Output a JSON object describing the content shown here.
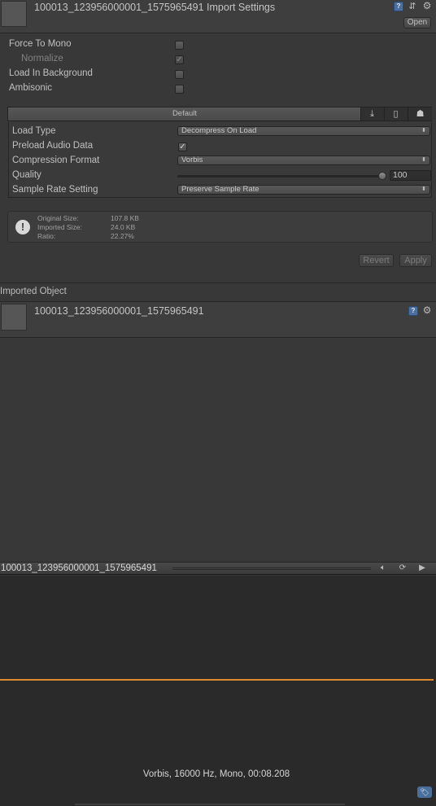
{
  "header": {
    "title": "100013_123956000001_1575965491 Import Settings",
    "open_label": "Open",
    "icons": [
      "help-book-icon",
      "presets-icon",
      "gear-icon"
    ]
  },
  "options": {
    "force_to_mono": {
      "label": "Force To Mono",
      "checked": false
    },
    "normalize": {
      "label": "Normalize",
      "checked": true
    },
    "load_in_background": {
      "label": "Load In Background",
      "checked": false
    },
    "ambisonic": {
      "label": "Ambisonic",
      "checked": false
    }
  },
  "platform_tabs": {
    "default_label": "Default",
    "icons": [
      "download-icon",
      "mobile-icon",
      "android-icon"
    ]
  },
  "settings": {
    "load_type": {
      "label": "Load Type",
      "value": "Decompress On Load"
    },
    "preload_audio_data": {
      "label": "Preload Audio Data",
      "checked": true
    },
    "compression_format": {
      "label": "Compression Format",
      "value": "Vorbis"
    },
    "quality": {
      "label": "Quality",
      "value": "100",
      "level": 1.0
    },
    "sample_rate_setting": {
      "label": "Sample Rate Setting",
      "value": "Preserve Sample Rate"
    }
  },
  "info": {
    "original_size_label": "Original Size:",
    "original_size": "107.8 KB",
    "imported_size_label": "Imported Size:",
    "imported_size": "24.0 KB",
    "ratio_label": "Ratio:",
    "ratio": "22.27%"
  },
  "actions": {
    "revert_label": "Revert",
    "apply_label": "Apply"
  },
  "imported_object": {
    "section_label": "Imported Object",
    "name": "100013_123956000001_1575965491"
  },
  "preview": {
    "name": "100013_123956000001_1575965491",
    "audio_info": "Vorbis, 16000 Hz, Mono, 00:08.208",
    "waveform_color": "#e08a2e"
  },
  "colors": {
    "background": "#383838",
    "preview_background": "#2a2a2a",
    "tag_accent": "#4a6f9b"
  }
}
